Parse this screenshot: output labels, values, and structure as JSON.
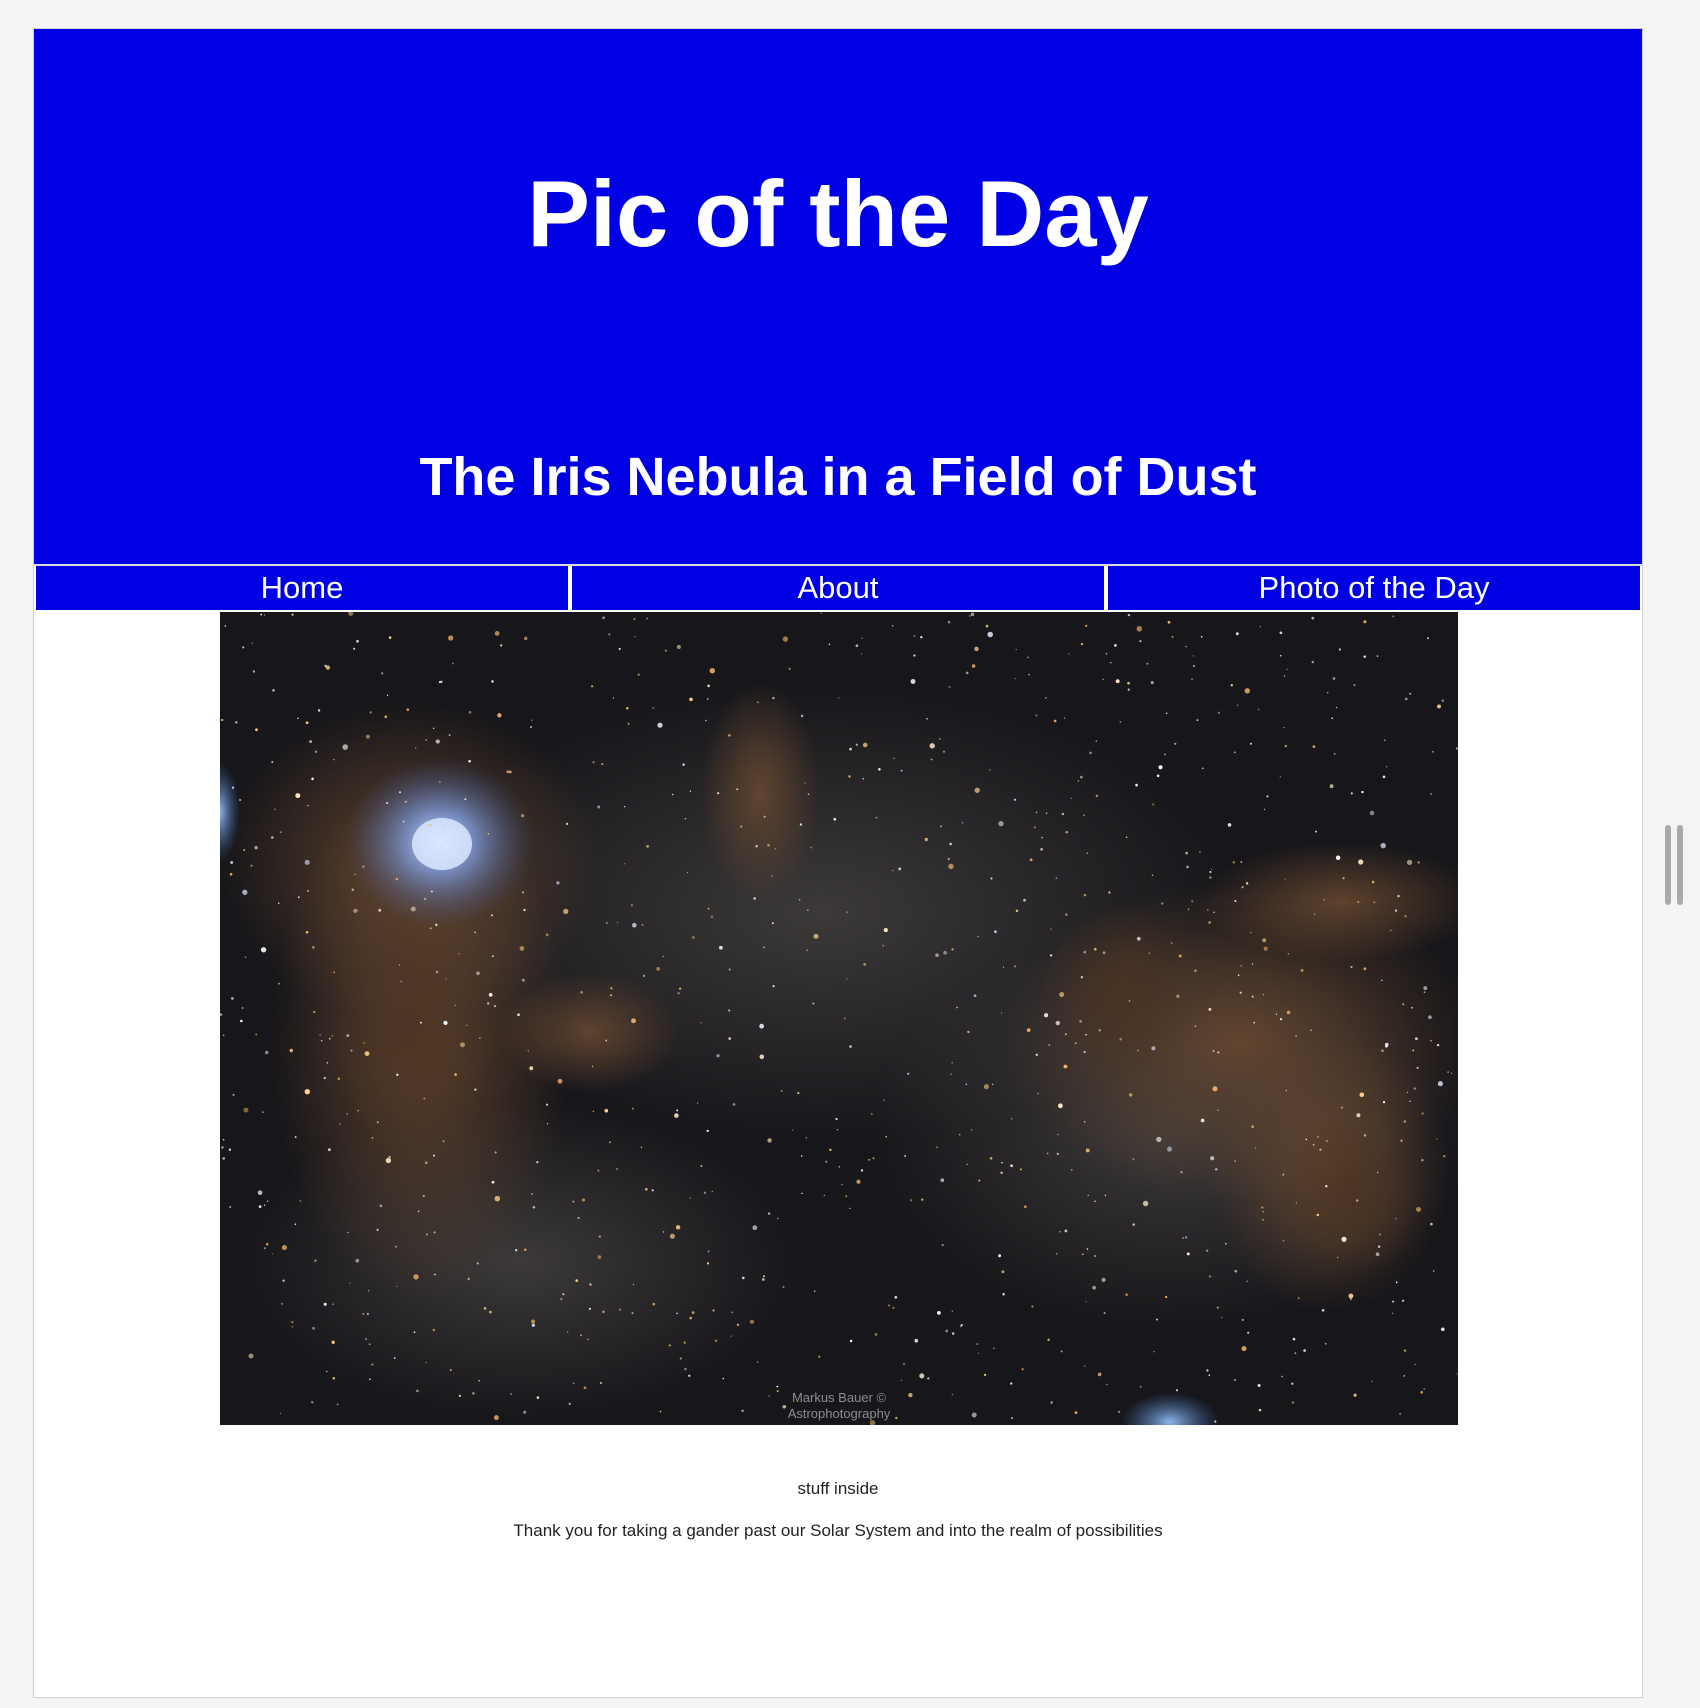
{
  "header": {
    "site_title": "Pic of the Day",
    "picture_title": "The Iris Nebula in a Field of Dust"
  },
  "nav": {
    "items": [
      {
        "label": "Home"
      },
      {
        "label": "About"
      },
      {
        "label": "Photo of the Day"
      }
    ]
  },
  "photo": {
    "watermark": "Markus Bauer © Astrophotography"
  },
  "content": {
    "caption": "stuff inside",
    "thanks": "Thank you for taking a gander past our Solar System and into the realm of possibilities"
  },
  "colors": {
    "header_blue": "#0000e4",
    "text_white": "#ffffff"
  }
}
